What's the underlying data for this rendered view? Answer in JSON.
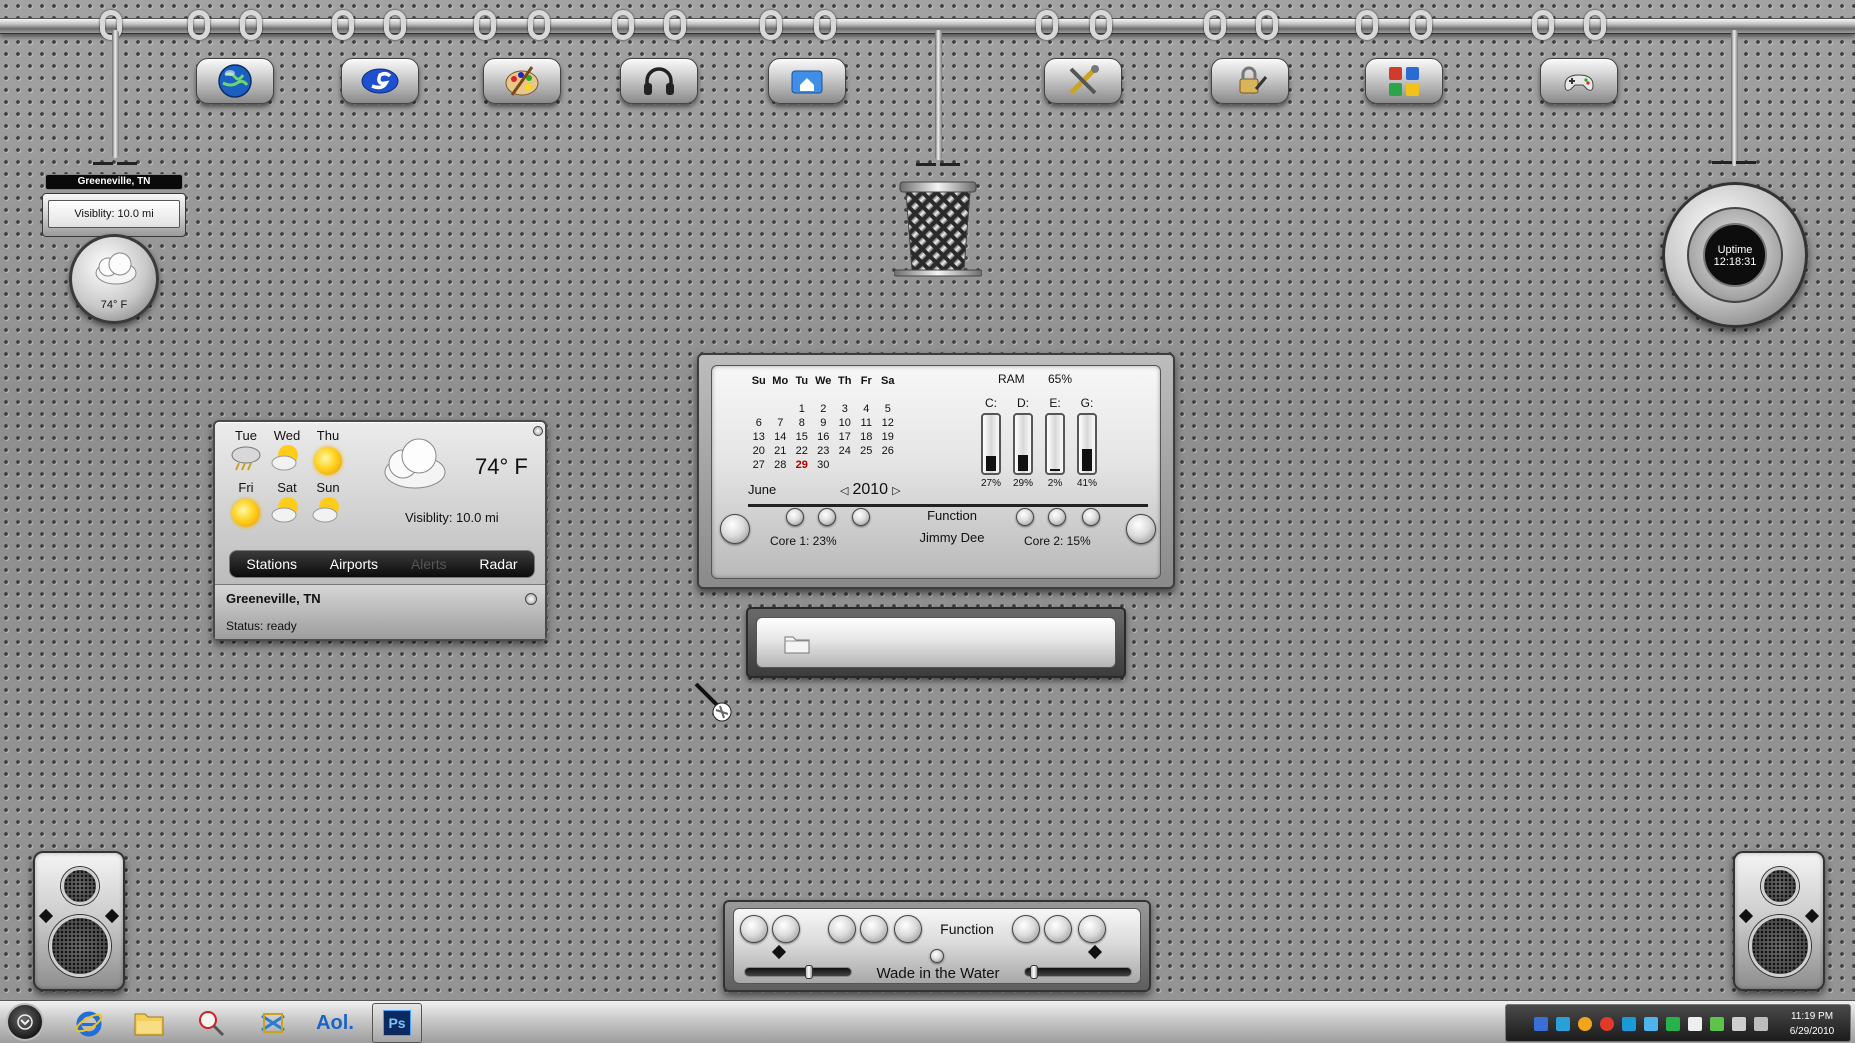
{
  "weather_mini": {
    "location": "Greeneville, TN",
    "visibility": "Visiblity: 10.0 mi",
    "temperature": "74° F"
  },
  "uptime": {
    "label": "Uptime",
    "value": "12:18:31"
  },
  "launcher_icons": [
    "globe-icon",
    "skype-icon",
    "paint-palette-icon",
    "headphones-icon",
    "home-folder-icon",
    "tools-icon",
    "lock-key-icon",
    "office-apps-icon",
    "gamepad-icon"
  ],
  "weather": {
    "forecast": [
      {
        "day": "Tue",
        "icon": "storm-icon"
      },
      {
        "day": "Wed",
        "icon": "partly-cloudy-icon"
      },
      {
        "day": "Thu",
        "icon": "sun-icon"
      },
      {
        "day": "Fri",
        "icon": "sun-icon"
      },
      {
        "day": "Sat",
        "icon": "partly-cloudy-icon"
      },
      {
        "day": "Sun",
        "icon": "partly-cloudy-icon"
      }
    ],
    "current_temp": "74° F",
    "visibility": "Visiblity: 10.0 mi",
    "tabs": [
      "Stations",
      "Airports",
      "Alerts",
      "Radar"
    ],
    "location": "Greeneville, TN",
    "status": "Status: ready"
  },
  "calendar": {
    "weekdays": [
      "Su",
      "Mo",
      "Tu",
      "We",
      "Th",
      "Fr",
      "Sa"
    ],
    "weeks": [
      [
        "",
        "",
        "1",
        "2",
        "3",
        "4",
        "5"
      ],
      [
        "6",
        "7",
        "8",
        "9",
        "10",
        "11",
        "12"
      ],
      [
        "13",
        "14",
        "15",
        "16",
        "17",
        "18",
        "19"
      ],
      [
        "20",
        "21",
        "22",
        "23",
        "24",
        "25",
        "26"
      ],
      [
        "27",
        "28",
        "29",
        "30",
        "",
        "",
        ""
      ]
    ],
    "today": "29",
    "month": "June",
    "year": "2010",
    "prev": "◁",
    "next": "▷"
  },
  "system": {
    "ram_label": "RAM",
    "ram_value": "65%",
    "drives": [
      {
        "label": "C:",
        "percent": "27%",
        "fill": 0.27
      },
      {
        "label": "D:",
        "percent": "29%",
        "fill": 0.29
      },
      {
        "label": "E:",
        "percent": "2%",
        "fill": 0.02
      },
      {
        "label": "G:",
        "percent": "41%",
        "fill": 0.41
      }
    ],
    "function_label": "Function",
    "user": "Jimmy Dee",
    "core1": "Core 1:  23%",
    "core2": "Core 2:  15%"
  },
  "player": {
    "function_label": "Function",
    "track": "Wade in the Water",
    "volume_left": 0.6,
    "volume_right": 0.05
  },
  "taskbar": {
    "apps": [
      "internet-explorer-icon",
      "explorer-folder-icon",
      "rocketdock-icon",
      "outlook-icon",
      "aol-icon",
      "photoshop-icon"
    ],
    "aol_label": "Aol.",
    "ps_label": "Ps",
    "time": "11:19 PM",
    "date": "6/29/2010"
  },
  "colors": {
    "today": "#b00000",
    "tab_bar": "#0b0b0b",
    "tray": "#1b1b1b"
  }
}
